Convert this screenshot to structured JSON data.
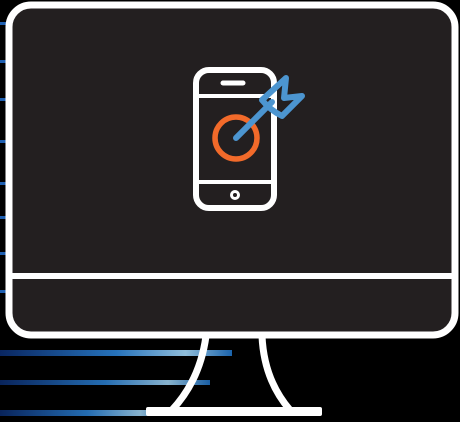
{
  "illustration": {
    "subject": "monitor-with-smartphone-target-icon",
    "icons": [
      "desktop-monitor-icon",
      "smartphone-icon",
      "target-icon",
      "arrow-icon"
    ],
    "colors": {
      "background": "#000000",
      "screen": "#231f20",
      "outline": "#ffffff",
      "target": "#f26a2a",
      "arrow": "#4c95d0",
      "streak_blue": "#1e6fc0"
    }
  }
}
